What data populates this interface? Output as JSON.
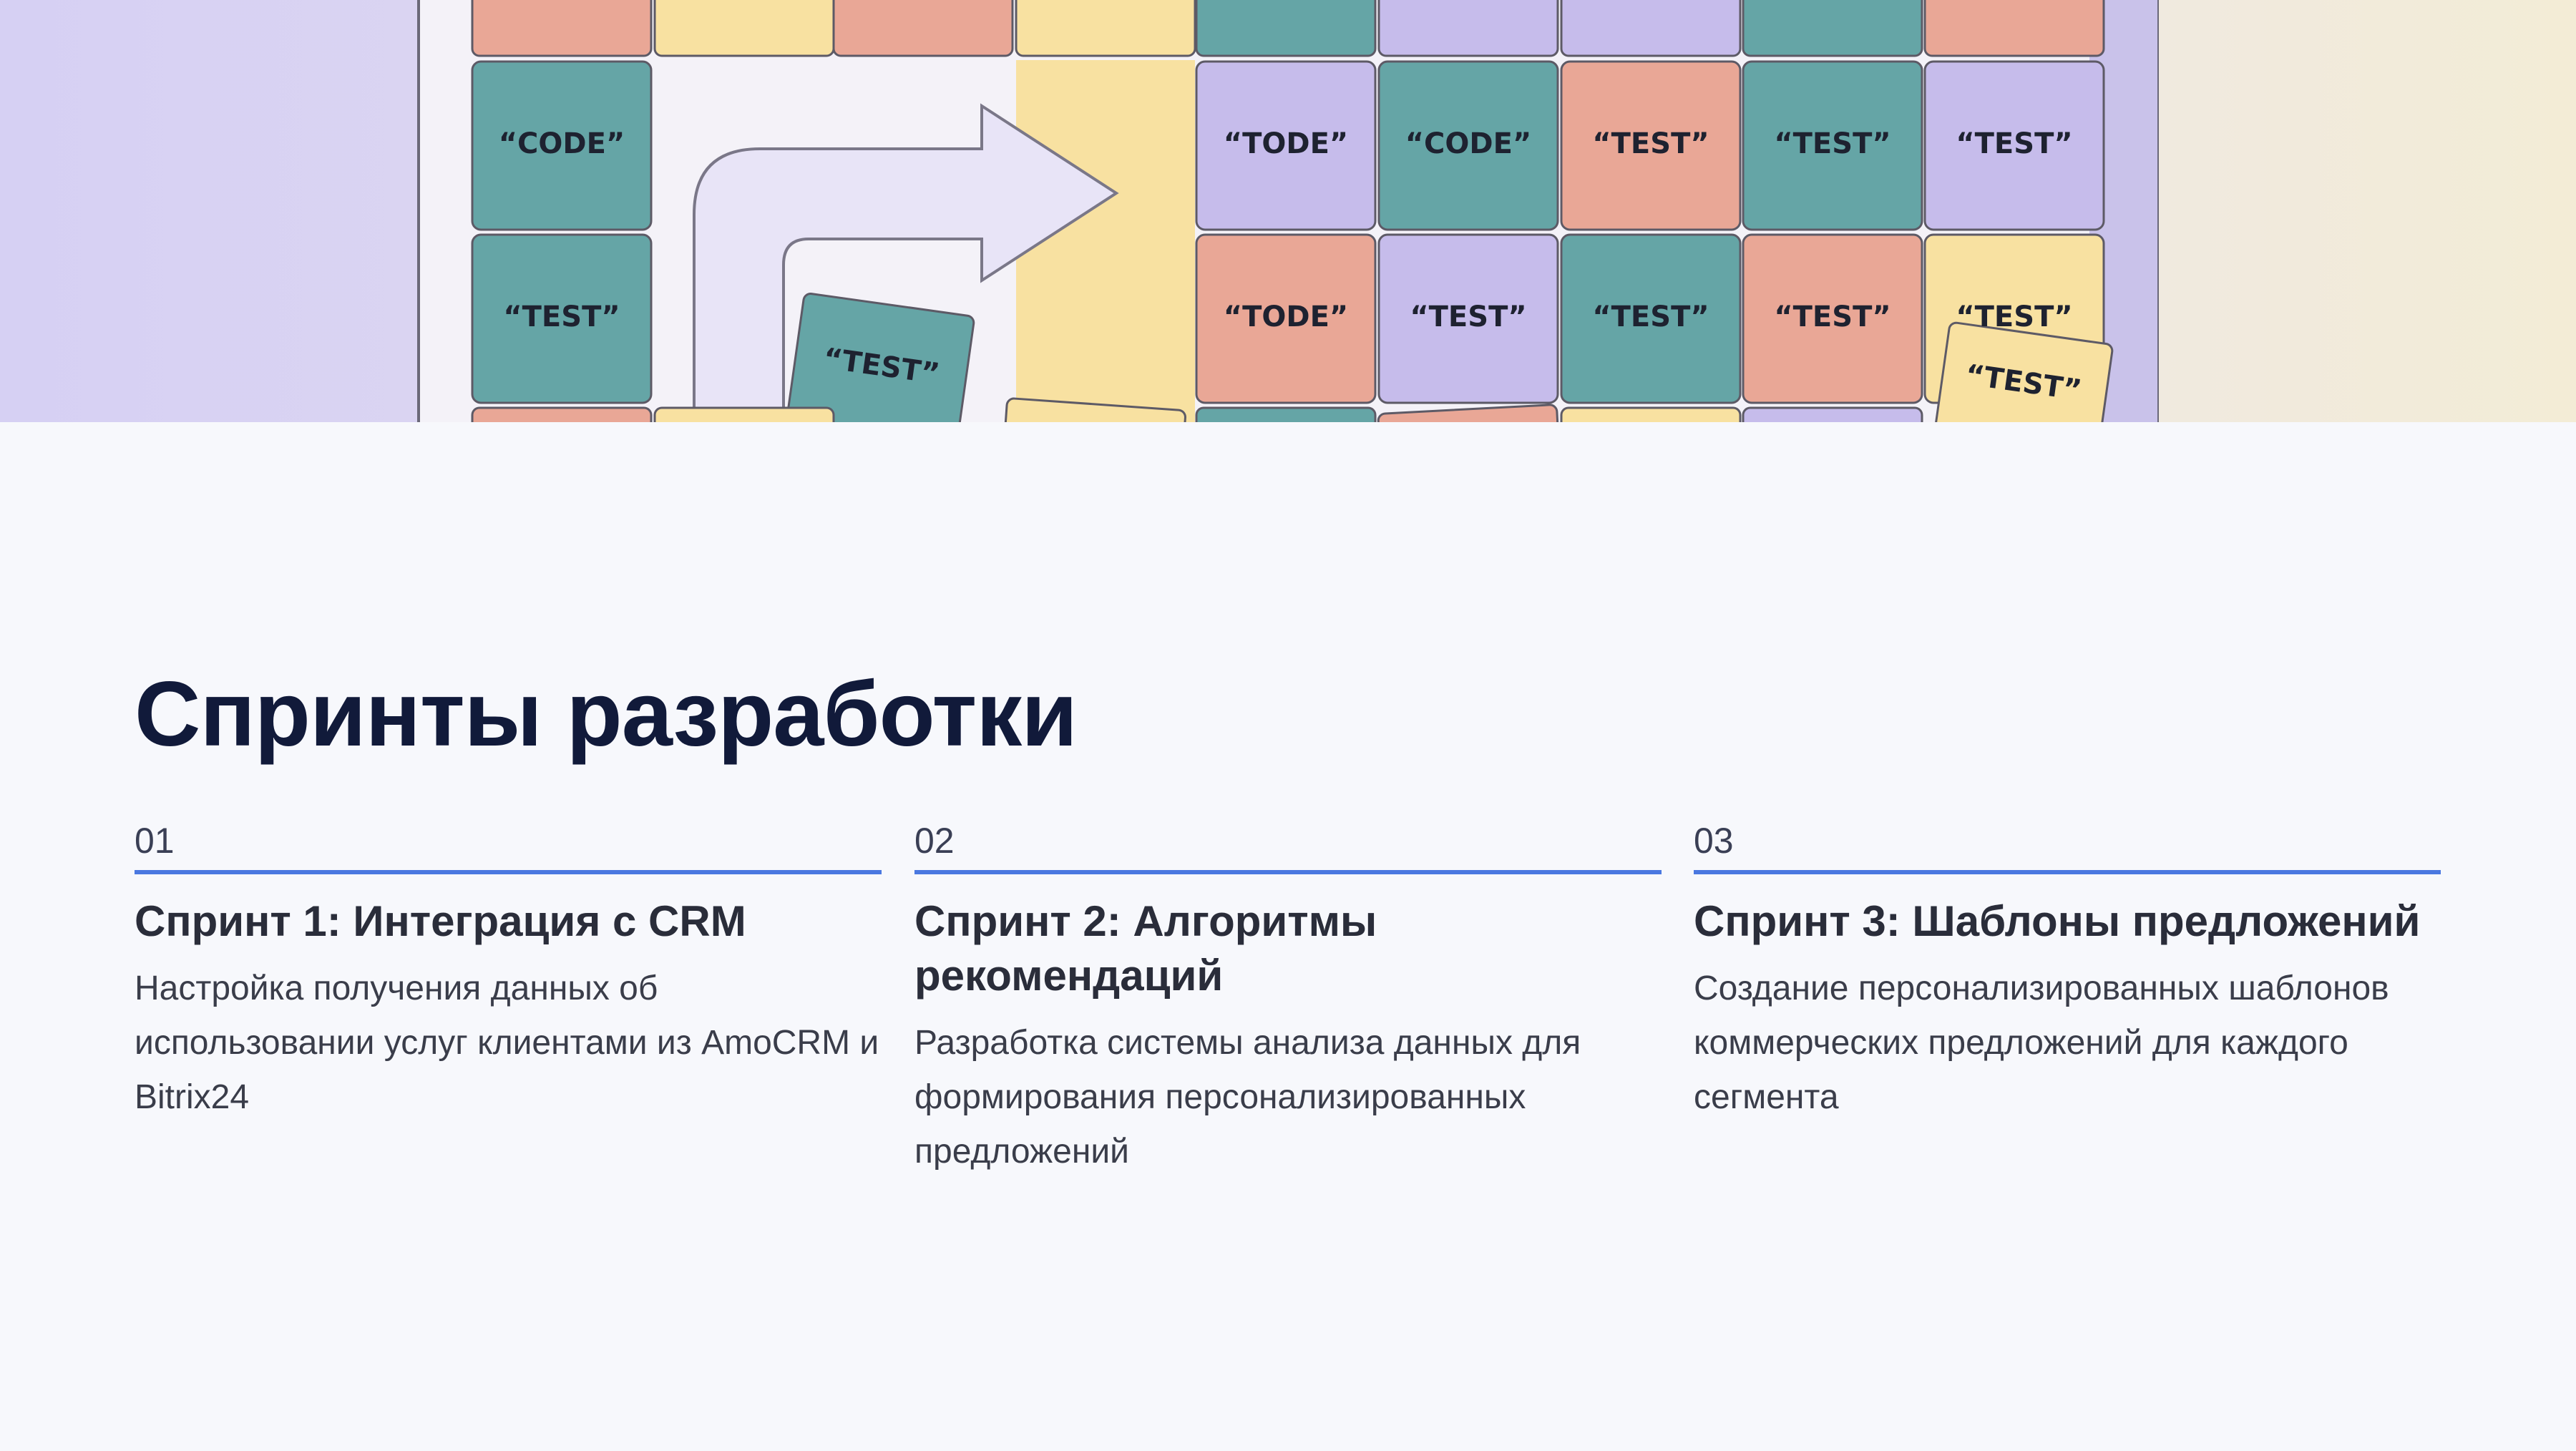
{
  "hero": {
    "illustration": "kanban-board-illustration",
    "cards": [
      {
        "label": "“CODE”"
      },
      {
        "label": "“TEST”"
      },
      {
        "label": "“TEST”"
      },
      {
        "label": "“TODE”"
      },
      {
        "label": "“CODE”"
      },
      {
        "label": "“TEST”"
      },
      {
        "label": "“TEST”"
      },
      {
        "label": "“TEST”"
      },
      {
        "label": "“TODE”"
      },
      {
        "label": "“TEST”"
      },
      {
        "label": "“TEST”"
      },
      {
        "label": "“TEST”"
      },
      {
        "label": "“TEST”"
      },
      {
        "label": "“TEST”"
      }
    ],
    "colors": {
      "teal": "#65a5a6",
      "salmon": "#e9a796",
      "lavender": "#c6bceb",
      "yellow": "#f8e1a1"
    }
  },
  "section": {
    "title": "Спринты разработки",
    "sprints": [
      {
        "number": "01",
        "title": "Спринт 1: Интеграция с CRM",
        "description": "Настройка получения данных об использовании услуг клиентами из AmoCRM и Bitrix24"
      },
      {
        "number": "02",
        "title": "Спринт 2: Алгоритмы рекомендаций",
        "description": "Разработка системы анализа данных для формирования персонализированных предложений"
      },
      {
        "number": "03",
        "title": "Спринт 3: Шаблоны предложений",
        "description": "Создание персонализированных шаблонов коммерческих предложений для каждого сегмента"
      }
    ],
    "accent_color": "#4a78e0"
  }
}
